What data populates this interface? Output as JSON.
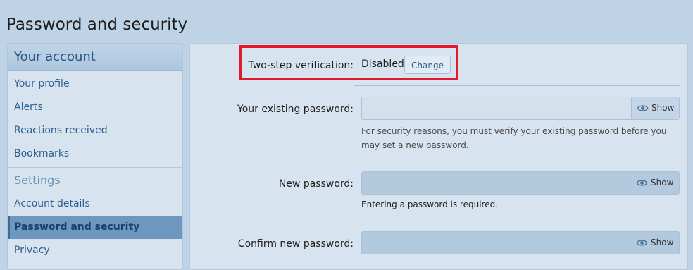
{
  "page": {
    "title": "Password and security"
  },
  "sidebar": {
    "header": "Your account",
    "items": [
      {
        "label": "Your profile"
      },
      {
        "label": "Alerts"
      },
      {
        "label": "Reactions received"
      },
      {
        "label": "Bookmarks"
      }
    ],
    "section_title": "Settings",
    "settings_items": [
      {
        "label": "Account details"
      },
      {
        "label": "Password and security",
        "active": true
      },
      {
        "label": "Privacy"
      }
    ]
  },
  "form": {
    "two_step": {
      "label": "Two-step verification:",
      "status": "Disabled",
      "button": "Change"
    },
    "existing_password": {
      "label": "Your existing password:",
      "value": "",
      "show_label": "Show",
      "hint": "For security reasons, you must verify your existing password before you may set a new password."
    },
    "new_password": {
      "label": "New password:",
      "value": "",
      "show_label": "Show",
      "note": "Entering a password is required."
    },
    "confirm_password": {
      "label": "Confirm new password:",
      "value": "",
      "show_label": "Show"
    }
  },
  "colors": {
    "highlight": "#e0192b",
    "link": "#2b5e93",
    "active_bg": "#6e97c0"
  },
  "icons": {
    "show": "eye-icon"
  }
}
